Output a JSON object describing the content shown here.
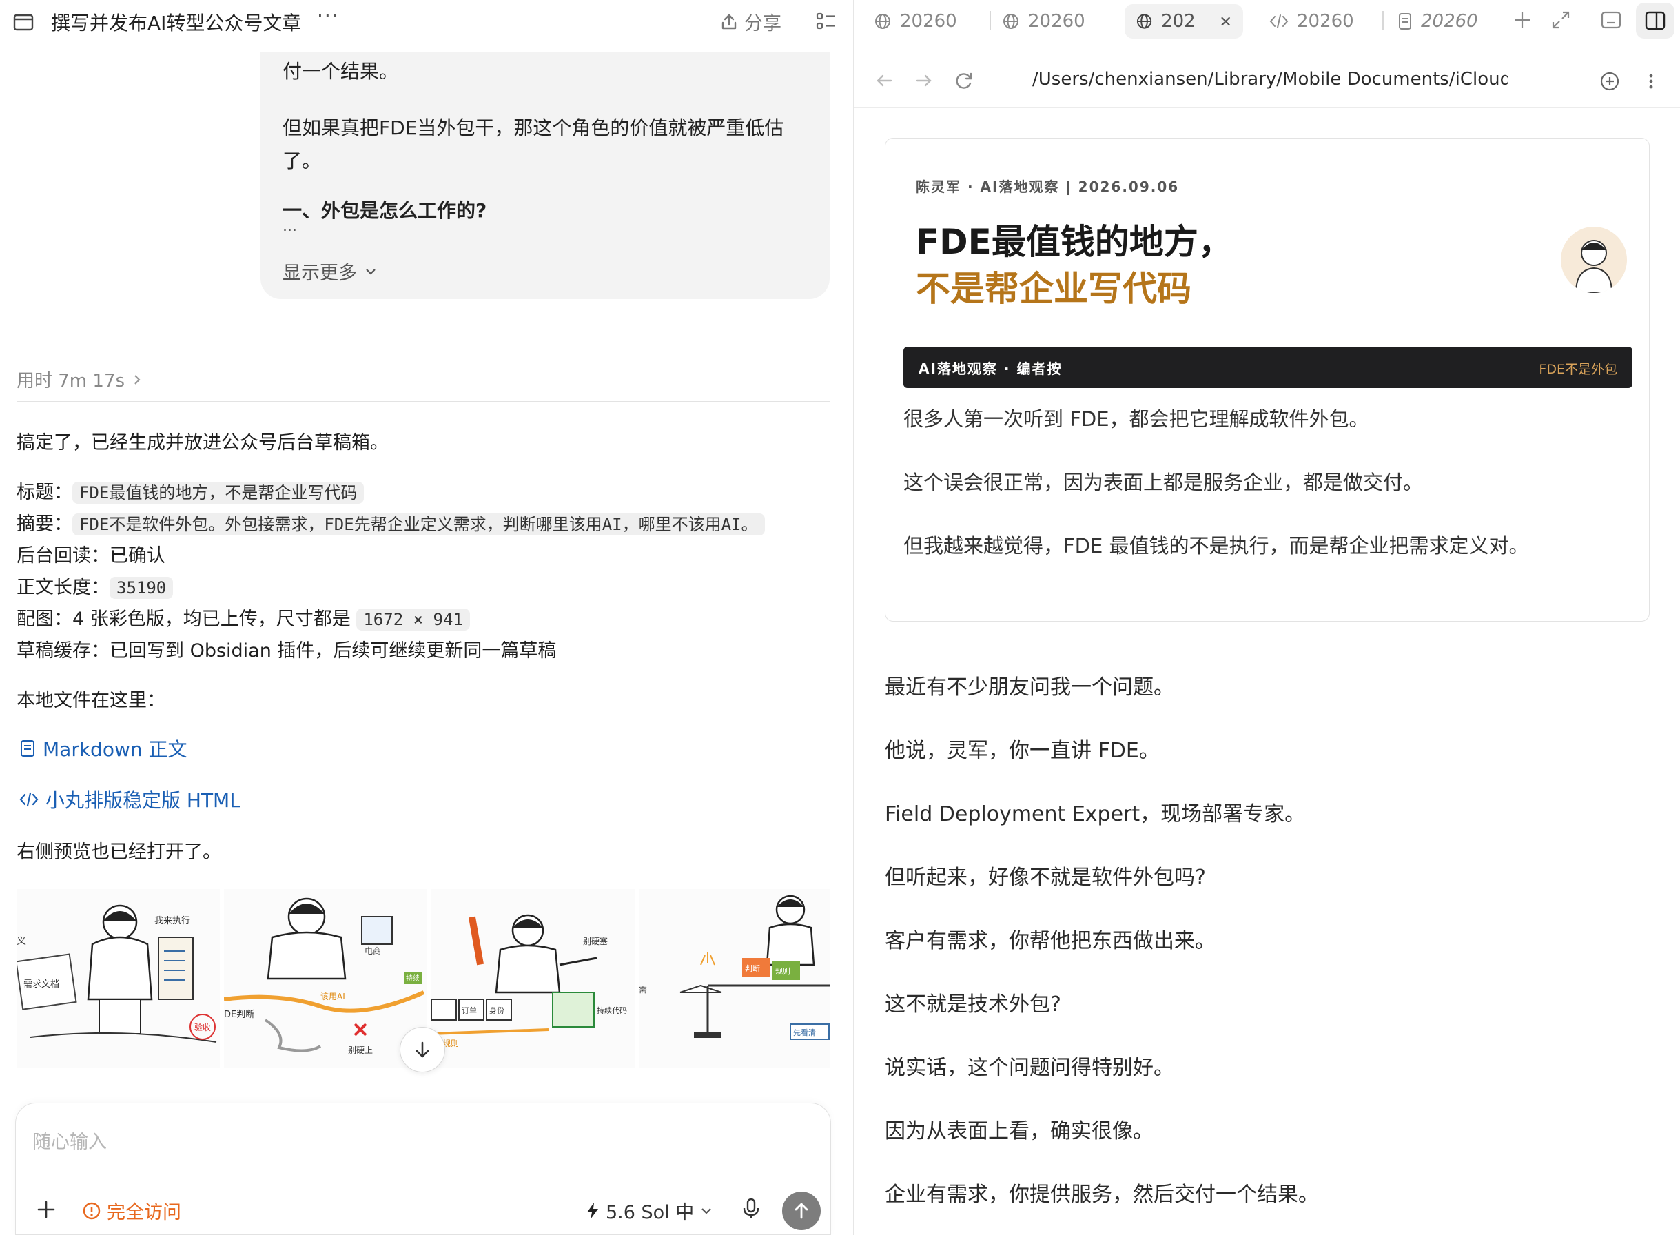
{
  "left": {
    "title": "撰写并发布AI转型公众号文章",
    "more": "···",
    "share_label": "分享",
    "user_message": {
      "line1": "付一个结果。",
      "line2": "但如果真把FDE当外包干，那这个角色的价值就被严重低估",
      "line3": "了。",
      "line4_partial": "一、外包是怎么工作的?",
      "ellipsis": "...",
      "show_more": "显示更多"
    },
    "elapsed": "用时 7m 17s",
    "assistant": {
      "intro": "搞定了，已经生成并放进公众号后台草稿箱。",
      "title_label": "标题：",
      "title_value": "FDE最值钱的地方，不是帮企业写代码",
      "summary_label": "摘要：",
      "summary_value": "FDE不是软件外包。外包接需求，FDE先帮企业定义需求，判断哪里该用AI，哪里不该用AI。",
      "readback": "后台回读：已确认",
      "length_label": "正文长度：",
      "length_value": "35190",
      "images_prefix": "配图：4 张彩色版，均已上传，尺寸都是 ",
      "images_size": "1672 × 941",
      "cache": "草稿缓存：已回写到 Obsidian 插件，后续可继续更新同一篇草稿",
      "files_heading": "本地文件在这里：",
      "link_markdown": "Markdown 正文",
      "link_html": "小丸排版稳定版 HTML",
      "preview_note": "右侧预览也已经打开了。"
    },
    "gallery": {
      "img1": {
        "tag1": "我来执行",
        "tag2": "需求文档",
        "stamp": "验收",
        "edge": "义"
      },
      "img2": {
        "tag1": "电商",
        "tag2": "该用AI",
        "tag3": "DE判断",
        "tag4": "别硬上",
        "tag5": "持续"
      },
      "img3": {
        "tag1": "别硬塞",
        "tag2": "订单",
        "tag3": "身份",
        "tag4": "定规则",
        "tag5": "持续代码"
      },
      "img4": {
        "tag1": "判断",
        "tag2": "规则",
        "tag3": "先看清",
        "tag4": "需"
      }
    },
    "composer": {
      "placeholder": "随心输入",
      "access_label": "完全访问",
      "model_label": "5.6 Sol 中"
    }
  },
  "right": {
    "tabs": [
      {
        "label": "20260",
        "icon": "globe-icon"
      },
      {
        "label": "20260",
        "icon": "globe-icon"
      },
      {
        "label": "202",
        "icon": "globe-icon",
        "active": true
      },
      {
        "label": "20260",
        "icon": "code-icon"
      },
      {
        "label": "20260",
        "icon": "document-icon"
      }
    ],
    "url": "/Users/chenxiansen/Library/Mobile Documents/iCloud~md~obsidian",
    "article": {
      "byline": "陈灵军 · AI落地观察  |  2026.09.06",
      "heading_line1": "FDE最值钱的地方，",
      "heading_line2": "不是帮企业写代码",
      "banner_left": "AI落地观察 · 编者按",
      "banner_right": "FDE不是外包",
      "intro": [
        "很多人第一次听到 FDE，都会把它理解成软件外包。",
        "这个误会很正常，因为表面上都是服务企业，都是做交付。",
        "但我越来越觉得，FDE 最值钱的不是执行，而是帮企业把需求定义对。"
      ],
      "paragraphs": [
        "最近有不少朋友问我一个问题。",
        "他说，灵军，你一直讲 FDE。",
        "Field Deployment Expert，现场部署专家。",
        "但听起来，好像不就是软件外包吗?",
        "客户有需求，你帮他把东西做出来。",
        "这不就是技术外包?",
        "说实话，这个问题问得特别好。",
        "因为从表面上看，确实很像。",
        "企业有需求，你提供服务，然后交付一个结果。"
      ]
    }
  },
  "colors": {
    "accent_gold": "#b5751a",
    "link_blue": "#1a5fb4",
    "warning_orange": "#e8681e",
    "banner_dark": "#1f1f21"
  }
}
